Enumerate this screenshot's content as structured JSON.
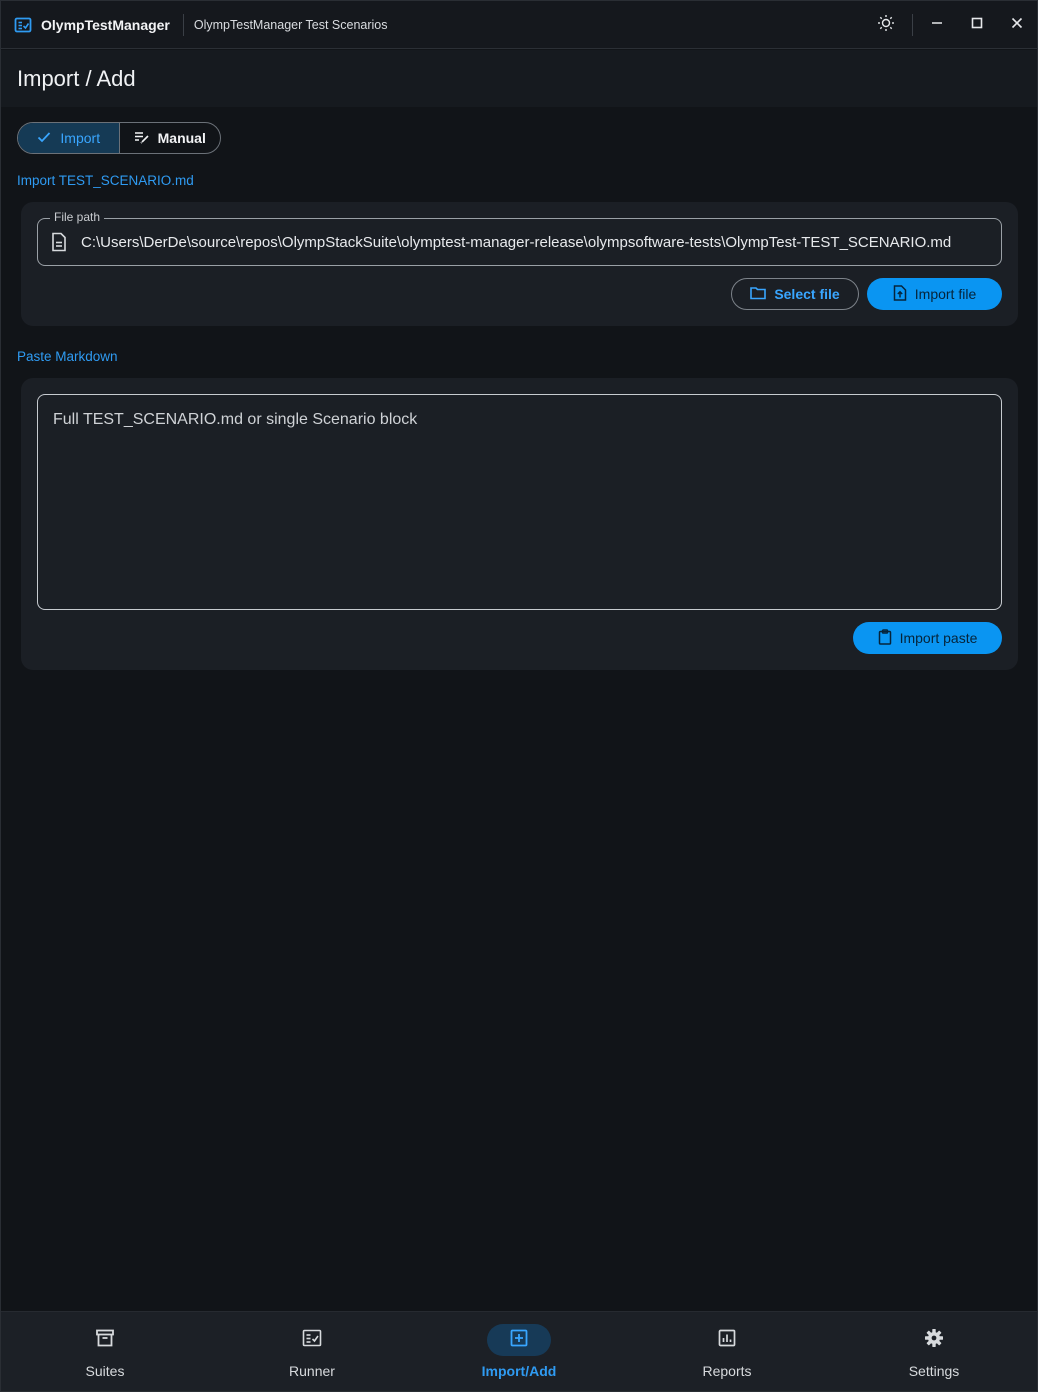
{
  "titlebar": {
    "app_name": "OlympTestManager",
    "window_title": "OlympTestManager Test Scenarios",
    "icons": [
      "app-logo-icon",
      "theme-toggle-icon",
      "minimize-icon",
      "maximize-icon",
      "close-icon"
    ]
  },
  "header": {
    "title": "Import / Add"
  },
  "mode_toggle": {
    "selected": "Import",
    "options": [
      {
        "label": "Import",
        "icon": "check-icon"
      },
      {
        "label": "Manual",
        "icon": "edit-note-icon"
      }
    ]
  },
  "import_file": {
    "section_title": "Import TEST_SCENARIO.md",
    "field_label": "File path",
    "field_value": "C:\\Users\\DerDe\\source\\repos\\OlympStackSuite\\olymptest-manager-release\\olympsoftware-tests\\OlympTest-TEST_SCENARIO.md",
    "select_button": "Select file",
    "import_button": "Import file"
  },
  "paste_markdown": {
    "section_title": "Paste Markdown",
    "placeholder": "Full TEST_SCENARIO.md or single Scenario block",
    "import_button": "Import paste"
  },
  "bottom_nav": {
    "active": "Import/Add",
    "items": [
      {
        "label": "Suites",
        "icon": "archive-icon"
      },
      {
        "label": "Runner",
        "icon": "checklist-icon"
      },
      {
        "label": "Import/Add",
        "icon": "add-box-icon"
      },
      {
        "label": "Reports",
        "icon": "chart-icon"
      },
      {
        "label": "Settings",
        "icon": "gear-icon"
      }
    ]
  },
  "colors": {
    "background": "#111418",
    "card": "#1b1f25",
    "accent": "#2f9bf2",
    "primary_button": "#0a95f2"
  }
}
